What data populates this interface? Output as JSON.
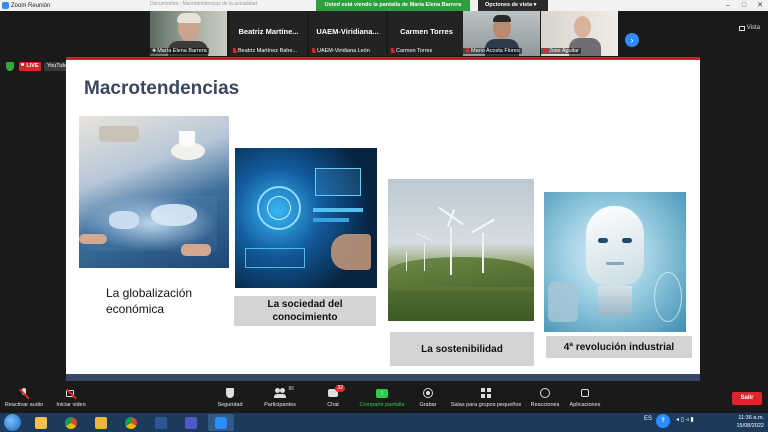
{
  "window": {
    "title": "Zoom Reunión",
    "ghost_text": "Documentos - Macrotendencias de la actualidad",
    "minimize": "–",
    "maximize": "□",
    "close": "✕"
  },
  "share_banner": "Usted está viendo la pantalla de María Elena Barrera",
  "view_options": "Opciones de vista ▾",
  "view_button": "Vista",
  "participants": [
    {
      "display": "video",
      "name": "María Elena Barrera",
      "muted": false
    },
    {
      "display": "name",
      "big_name": "Beatriz Martíne...",
      "name": "Beatriz Martínez Bahe...",
      "muted": true
    },
    {
      "display": "name",
      "big_name": "UAEM-Viridiana...",
      "name": "UAEM-Viridiana León",
      "muted": true
    },
    {
      "display": "name",
      "big_name": "Carmen Torres",
      "name": "Carmen Torres",
      "muted": true
    },
    {
      "display": "video",
      "name": "Mario Acosta Flores",
      "muted": true
    },
    {
      "display": "video",
      "name": "Jose Aguilar",
      "muted": true
    }
  ],
  "live": {
    "badge": "LIVE",
    "platform": "YouTube ▾"
  },
  "slide": {
    "title": "Macrotendencias",
    "items": [
      {
        "label": "La globalización económica",
        "icon": "world-map-business-image"
      },
      {
        "label": "La sociedad del conocimiento",
        "icon": "digital-interface-image"
      },
      {
        "label": "La sostenibilidad",
        "icon": "wind-turbines-image"
      },
      {
        "label": "4ª revolución industrial",
        "icon": "robot-ai-image"
      }
    ]
  },
  "toolbar": {
    "audio": "Reactivar audio",
    "video": "Iniciar video",
    "security": "Seguridad",
    "participants": "Participantes",
    "participants_count": "86",
    "chat": "Chat",
    "chat_badge": "32",
    "share": "Compartir pantalla",
    "record": "Grabar",
    "rooms": "Salas para grupos pequeños",
    "reactions": "Reacciones",
    "apps": "Aplicaciones",
    "leave": "Salir"
  },
  "taskbar": {
    "language": "ES",
    "time": "11:36 a.m.",
    "date": "15/08/2022"
  },
  "colors": {
    "accent_red": "#d11f2a",
    "zoom_blue": "#2d8cff",
    "share_green": "#2e9f3e",
    "slide_navy": "#384764"
  }
}
